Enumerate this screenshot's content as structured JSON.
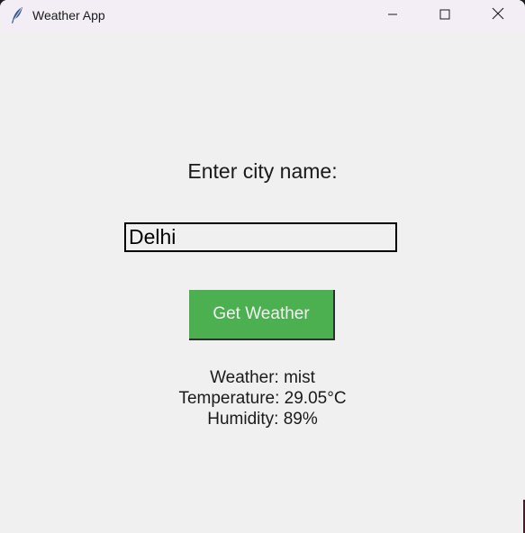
{
  "window": {
    "title": "Weather App",
    "app_icon": "feather-icon"
  },
  "controls": {
    "minimize_icon": "minimize-icon",
    "maximize_icon": "maximize-icon",
    "close_icon": "close-icon"
  },
  "form": {
    "prompt_label": "Enter city name:",
    "city_value": "Delhi",
    "button_label": "Get Weather",
    "button_color": "#4caf50"
  },
  "result": {
    "weather": "Weather: mist",
    "temperature": "Temperature: 29.05°C",
    "humidity": "Humidity: 89%"
  }
}
